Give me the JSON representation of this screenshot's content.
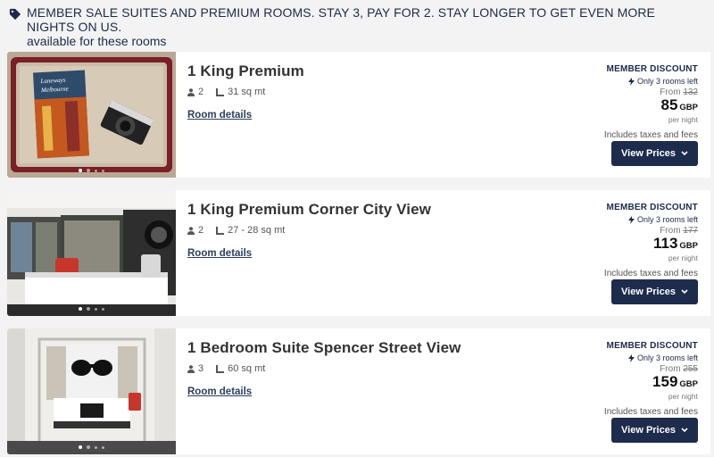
{
  "banner": {
    "line1": "MEMBER SALE SUITES AND PREMIUM ROOMS. STAY 3, PAY FOR 2. STAY LONGER TO GET EVEN MORE NIGHTS ON US.",
    "line2": "available for these rooms",
    "icon": "tag-icon"
  },
  "rooms": [
    {
      "title": "1 King Premium",
      "guests": "2",
      "size": "31 sq mt",
      "details_link": "Room details",
      "member_label": "MEMBER DISCOUNT",
      "rooms_left": "Only 3 rooms left",
      "from_label": "From",
      "old_price": "132",
      "price": "85",
      "currency": "GBP",
      "per_night": "per night",
      "taxes": "Includes taxes and fees",
      "button": "View Prices",
      "photo_caption": "Laneways Melbourne"
    },
    {
      "title": "1 King Premium Corner City View",
      "guests": "2",
      "size": "27 - 28 sq mt",
      "details_link": "Room details",
      "member_label": "MEMBER DISCOUNT",
      "rooms_left": "Only 3 rooms left",
      "from_label": "From",
      "old_price": "177",
      "price": "113",
      "currency": "GBP",
      "per_night": "per night",
      "taxes": "Includes taxes and fees",
      "button": "View Prices"
    },
    {
      "title": "1 Bedroom Suite Spencer Street View",
      "guests": "3",
      "size": "60 sq mt",
      "details_link": "Room details",
      "member_label": "MEMBER DISCOUNT",
      "rooms_left": "Only 3 rooms left",
      "from_label": "From",
      "old_price": "255",
      "price": "159",
      "currency": "GBP",
      "per_night": "per night",
      "taxes": "Includes taxes and fees",
      "button": "View Prices"
    }
  ],
  "colors": {
    "navy": "#1d2b4d",
    "page_bg": "#f3f3f3",
    "card_bg": "#ffffff"
  }
}
